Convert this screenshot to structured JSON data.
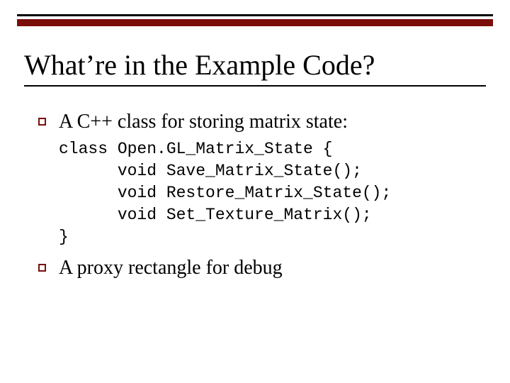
{
  "title": "What’re in the Example Code?",
  "bullets": {
    "b1": "A C++ class for storing matrix state:",
    "b2": "A proxy rectangle for debug"
  },
  "code": {
    "l1": "class Open.GL_Matrix_State {",
    "l2": "      void Save_Matrix_State();",
    "l3": "      void Restore_Matrix_State();",
    "l4": "      void Set_Texture_Matrix();",
    "l5": "}"
  }
}
